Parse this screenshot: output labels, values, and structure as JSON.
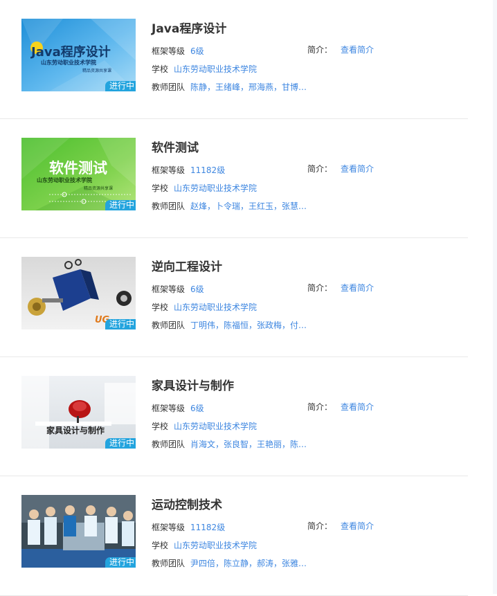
{
  "labels": {
    "level": "框架等级",
    "school": "学校",
    "team": "教师团队",
    "intro": "简介：",
    "view_intro": "查看简介",
    "status": "进行中"
  },
  "courses": [
    {
      "title": "Java程序设计",
      "level": "6级",
      "school": "山东劳动职业技术学院",
      "team": "陈静，王绪峰，邢海燕，甘博…",
      "thumb_title": "Java程序设计",
      "thumb_school": "山东劳动职业技术学院",
      "thumb_sub": "精品资源共享课"
    },
    {
      "title": "软件测试",
      "level": "11182级",
      "school": "山东劳动职业技术学院",
      "team": "赵烽，卜令瑞，王红玉，张慧…",
      "thumb_title": "软件测试",
      "thumb_school": "山东劳动职业技术学院",
      "thumb_sub": "精品资源共享课"
    },
    {
      "title": "逆向工程设计",
      "level": "6级",
      "school": "山东劳动职业技术学院",
      "team": "丁明伟，陈福恒，张政梅，付…",
      "thumb_mark": "UG"
    },
    {
      "title": "家具设计与制作",
      "level": "6级",
      "school": "山东劳动职业技术学院",
      "team": "肖海文，张良智，王艳丽，陈…",
      "thumb_title": "家具设计与制作"
    },
    {
      "title": "运动控制技术",
      "level": "11182级",
      "school": "山东劳动职业技术学院",
      "team": "尹四倍，陈立静，郝涛，张雅…"
    }
  ],
  "colors": {
    "link": "#3d86e0",
    "badge": "#23a4de",
    "divider": "#e8e8e8"
  }
}
